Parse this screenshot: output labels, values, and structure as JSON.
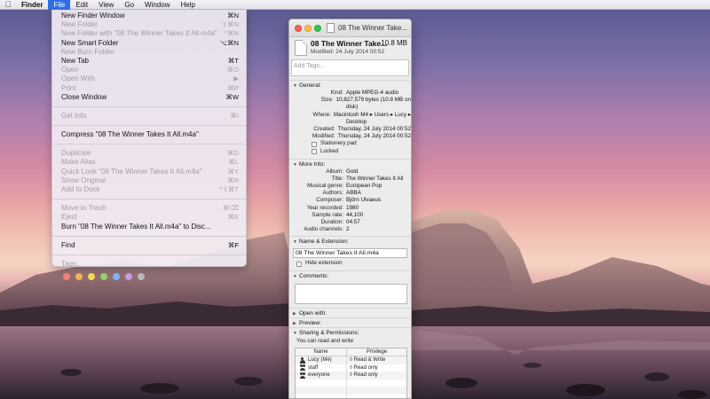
{
  "menubar": {
    "apple_icon": "apple-logo-icon",
    "items": [
      {
        "label": "Finder"
      },
      {
        "label": "File"
      },
      {
        "label": "Edit"
      },
      {
        "label": "View"
      },
      {
        "label": "Go"
      },
      {
        "label": "Window"
      },
      {
        "label": "Help"
      }
    ],
    "active_index": 1
  },
  "file_menu": {
    "items": [
      {
        "label": "New Finder Window",
        "shortcut": "⌘N",
        "enabled": true
      },
      {
        "label": "New Folder",
        "shortcut": "⇧⌘N",
        "enabled": false
      },
      {
        "label": "New Folder with \"08 The Winner Takes It All.m4a\"",
        "shortcut": "^⌘N",
        "enabled": false
      },
      {
        "label": "New Smart Folder",
        "shortcut": "⌥⌘N",
        "enabled": true
      },
      {
        "label": "New Burn Folder",
        "shortcut": "",
        "enabled": false
      },
      {
        "label": "New Tab",
        "shortcut": "⌘T",
        "enabled": true
      },
      {
        "label": "Open",
        "shortcut": "⌘O",
        "enabled": false
      },
      {
        "label": "Open With",
        "shortcut": "▶",
        "enabled": false
      },
      {
        "label": "Print",
        "shortcut": "⌘P",
        "enabled": false
      },
      {
        "label": "Close Window",
        "shortcut": "⌘W",
        "enabled": true
      },
      {
        "sep": true
      },
      {
        "label": "Get Info",
        "shortcut": "⌘I",
        "enabled": false
      },
      {
        "sep": true
      },
      {
        "label": "Compress \"08 The Winner Takes It All.m4a\"",
        "shortcut": "",
        "enabled": true
      },
      {
        "sep": true
      },
      {
        "label": "Duplicate",
        "shortcut": "⌘D",
        "enabled": false
      },
      {
        "label": "Make Alias",
        "shortcut": "⌘L",
        "enabled": false
      },
      {
        "label": "Quick Look \"08 The Winner Takes It All.m4a\"",
        "shortcut": "⌘Y",
        "enabled": false
      },
      {
        "label": "Show Original",
        "shortcut": "⌘R",
        "enabled": false
      },
      {
        "label": "Add to Dock",
        "shortcut": "^⇧⌘T",
        "enabled": false
      },
      {
        "sep": true
      },
      {
        "label": "Move to Trash",
        "shortcut": "⌘⌫",
        "enabled": false
      },
      {
        "label": "Eject",
        "shortcut": "⌘E",
        "enabled": false
      },
      {
        "label": "Burn \"08 The Winner Takes It All.m4a\" to Disc...",
        "shortcut": "",
        "enabled": true
      },
      {
        "sep": true
      },
      {
        "label": "Find",
        "shortcut": "⌘F",
        "enabled": true
      },
      {
        "sep": true
      },
      {
        "label": "Tags...",
        "shortcut": "",
        "enabled": false
      }
    ],
    "tag_colors": [
      "#f37f7b",
      "#f6b052",
      "#f2d84b",
      "#8fd26a",
      "#7cb3f3",
      "#c79ae6",
      "#b7b7bb"
    ]
  },
  "info_window": {
    "title": "08 The Winner Take...",
    "file_name": "08 The Winner Take...",
    "file_size": "10.8 MB",
    "modified": "Modified: 24 July 2014 00:52",
    "tags_placeholder": "Add Tags...",
    "general": {
      "heading": "General:",
      "rows": [
        {
          "key": "Kind:",
          "value": "Apple MPEG-4 audio"
        },
        {
          "key": "Size:",
          "value": "10,827,579 bytes (10.8 MB on"
        },
        {
          "key": "",
          "value": "disk)"
        },
        {
          "key": "Where:",
          "value": "Macintosh M4 ▸ Users ▸ Lucy ▸"
        },
        {
          "key": "",
          "value": "Desktop"
        },
        {
          "key": "Created:",
          "value": "Thursday, 24 July 2014 00:52"
        },
        {
          "key": "Modified:",
          "value": "Thursday, 24 July 2014 00:52"
        }
      ],
      "stationery_label": "Stationery pad",
      "locked_label": "Locked"
    },
    "more_info": {
      "heading": "More Info:",
      "rows": [
        {
          "key": "Album:",
          "value": "Gold"
        },
        {
          "key": "Title:",
          "value": "The Winner Takes It All"
        },
        {
          "key": "Musical genre:",
          "value": "European Pop"
        },
        {
          "key": "Authors:",
          "value": "ABBA"
        },
        {
          "key": "Composer:",
          "value": "Björn Ulvaeus"
        },
        {
          "key": "Year recorded:",
          "value": "1980"
        },
        {
          "key": "Sample rate:",
          "value": "44,100"
        },
        {
          "key": "Duration:",
          "value": "04:57"
        },
        {
          "key": "Audio channels:",
          "value": "2"
        }
      ]
    },
    "name_ext": {
      "heading": "Name & Extension:",
      "value": "08 The Winner Takes It All.m4a",
      "hide_ext_label": "Hide extension"
    },
    "comments_heading": "Comments:",
    "open_with_heading": "Open with:",
    "preview_heading": "Preview:",
    "sharing": {
      "heading": "Sharing & Permissions:",
      "note": "You can read and write",
      "col_name": "Name",
      "col_priv": "Privilege",
      "rows": [
        {
          "name": "Lucy (Me)",
          "privilege": "◊ Read & Write",
          "icon": "user-icon"
        },
        {
          "name": "staff",
          "privilege": "◊ Read only",
          "icon": "group-icon"
        },
        {
          "name": "everyone",
          "privilege": "◊ Read only",
          "icon": "group-icon"
        }
      ]
    }
  }
}
